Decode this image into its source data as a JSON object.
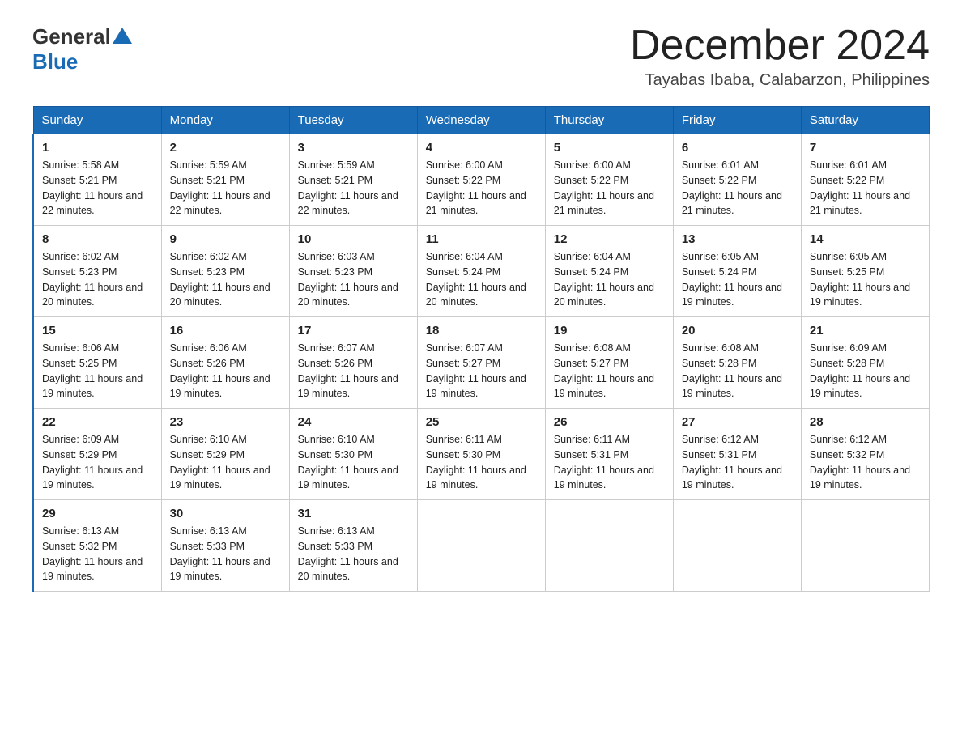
{
  "header": {
    "logo_general": "General",
    "logo_blue": "Blue",
    "month_title": "December 2024",
    "location": "Tayabas Ibaba, Calabarzon, Philippines"
  },
  "days_of_week": [
    "Sunday",
    "Monday",
    "Tuesday",
    "Wednesday",
    "Thursday",
    "Friday",
    "Saturday"
  ],
  "weeks": [
    [
      {
        "day": "1",
        "sunrise": "5:58 AM",
        "sunset": "5:21 PM",
        "daylight": "11 hours and 22 minutes."
      },
      {
        "day": "2",
        "sunrise": "5:59 AM",
        "sunset": "5:21 PM",
        "daylight": "11 hours and 22 minutes."
      },
      {
        "day": "3",
        "sunrise": "5:59 AM",
        "sunset": "5:21 PM",
        "daylight": "11 hours and 22 minutes."
      },
      {
        "day": "4",
        "sunrise": "6:00 AM",
        "sunset": "5:22 PM",
        "daylight": "11 hours and 21 minutes."
      },
      {
        "day": "5",
        "sunrise": "6:00 AM",
        "sunset": "5:22 PM",
        "daylight": "11 hours and 21 minutes."
      },
      {
        "day": "6",
        "sunrise": "6:01 AM",
        "sunset": "5:22 PM",
        "daylight": "11 hours and 21 minutes."
      },
      {
        "day": "7",
        "sunrise": "6:01 AM",
        "sunset": "5:22 PM",
        "daylight": "11 hours and 21 minutes."
      }
    ],
    [
      {
        "day": "8",
        "sunrise": "6:02 AM",
        "sunset": "5:23 PM",
        "daylight": "11 hours and 20 minutes."
      },
      {
        "day": "9",
        "sunrise": "6:02 AM",
        "sunset": "5:23 PM",
        "daylight": "11 hours and 20 minutes."
      },
      {
        "day": "10",
        "sunrise": "6:03 AM",
        "sunset": "5:23 PM",
        "daylight": "11 hours and 20 minutes."
      },
      {
        "day": "11",
        "sunrise": "6:04 AM",
        "sunset": "5:24 PM",
        "daylight": "11 hours and 20 minutes."
      },
      {
        "day": "12",
        "sunrise": "6:04 AM",
        "sunset": "5:24 PM",
        "daylight": "11 hours and 20 minutes."
      },
      {
        "day": "13",
        "sunrise": "6:05 AM",
        "sunset": "5:24 PM",
        "daylight": "11 hours and 19 minutes."
      },
      {
        "day": "14",
        "sunrise": "6:05 AM",
        "sunset": "5:25 PM",
        "daylight": "11 hours and 19 minutes."
      }
    ],
    [
      {
        "day": "15",
        "sunrise": "6:06 AM",
        "sunset": "5:25 PM",
        "daylight": "11 hours and 19 minutes."
      },
      {
        "day": "16",
        "sunrise": "6:06 AM",
        "sunset": "5:26 PM",
        "daylight": "11 hours and 19 minutes."
      },
      {
        "day": "17",
        "sunrise": "6:07 AM",
        "sunset": "5:26 PM",
        "daylight": "11 hours and 19 minutes."
      },
      {
        "day": "18",
        "sunrise": "6:07 AM",
        "sunset": "5:27 PM",
        "daylight": "11 hours and 19 minutes."
      },
      {
        "day": "19",
        "sunrise": "6:08 AM",
        "sunset": "5:27 PM",
        "daylight": "11 hours and 19 minutes."
      },
      {
        "day": "20",
        "sunrise": "6:08 AM",
        "sunset": "5:28 PM",
        "daylight": "11 hours and 19 minutes."
      },
      {
        "day": "21",
        "sunrise": "6:09 AM",
        "sunset": "5:28 PM",
        "daylight": "11 hours and 19 minutes."
      }
    ],
    [
      {
        "day": "22",
        "sunrise": "6:09 AM",
        "sunset": "5:29 PM",
        "daylight": "11 hours and 19 minutes."
      },
      {
        "day": "23",
        "sunrise": "6:10 AM",
        "sunset": "5:29 PM",
        "daylight": "11 hours and 19 minutes."
      },
      {
        "day": "24",
        "sunrise": "6:10 AM",
        "sunset": "5:30 PM",
        "daylight": "11 hours and 19 minutes."
      },
      {
        "day": "25",
        "sunrise": "6:11 AM",
        "sunset": "5:30 PM",
        "daylight": "11 hours and 19 minutes."
      },
      {
        "day": "26",
        "sunrise": "6:11 AM",
        "sunset": "5:31 PM",
        "daylight": "11 hours and 19 minutes."
      },
      {
        "day": "27",
        "sunrise": "6:12 AM",
        "sunset": "5:31 PM",
        "daylight": "11 hours and 19 minutes."
      },
      {
        "day": "28",
        "sunrise": "6:12 AM",
        "sunset": "5:32 PM",
        "daylight": "11 hours and 19 minutes."
      }
    ],
    [
      {
        "day": "29",
        "sunrise": "6:13 AM",
        "sunset": "5:32 PM",
        "daylight": "11 hours and 19 minutes."
      },
      {
        "day": "30",
        "sunrise": "6:13 AM",
        "sunset": "5:33 PM",
        "daylight": "11 hours and 19 minutes."
      },
      {
        "day": "31",
        "sunrise": "6:13 AM",
        "sunset": "5:33 PM",
        "daylight": "11 hours and 20 minutes."
      },
      null,
      null,
      null,
      null
    ]
  ]
}
